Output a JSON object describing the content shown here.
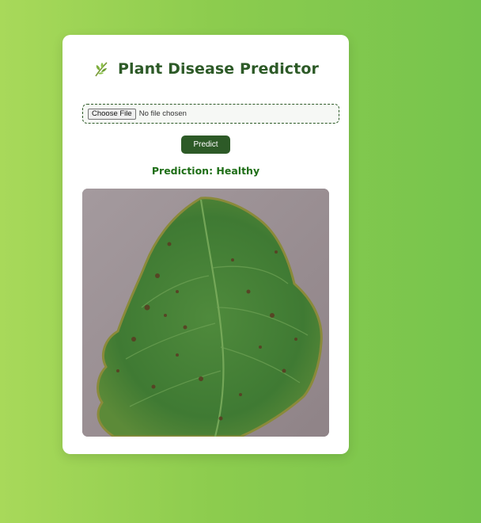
{
  "header": {
    "title": "Plant Disease Predictor",
    "icon": "leaf-icon"
  },
  "upload": {
    "button_label": "Choose File",
    "status_text": "No file chosen"
  },
  "actions": {
    "predict_label": "Predict"
  },
  "result": {
    "prediction_text": "Prediction: Healthy"
  },
  "image": {
    "subject": "leaf-photo"
  },
  "colors": {
    "primary": "#2d5a27",
    "prediction": "#1e6e16",
    "background_start": "#a8d95a",
    "background_end": "#76c44d"
  }
}
